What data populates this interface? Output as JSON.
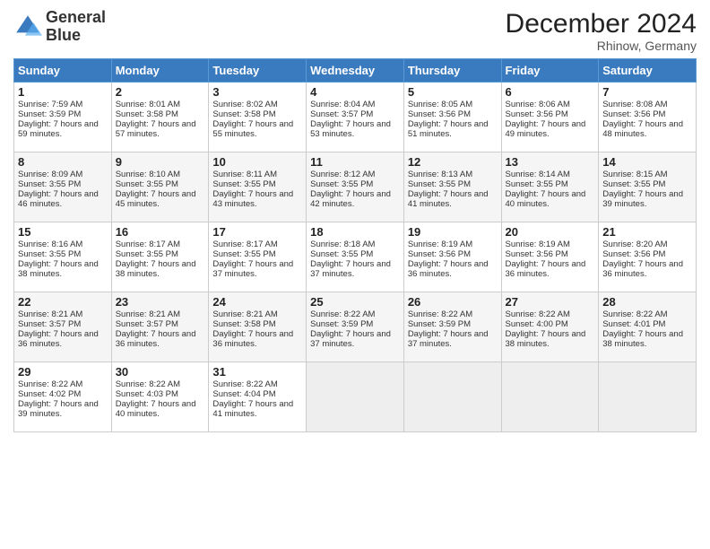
{
  "header": {
    "logo_line1": "General",
    "logo_line2": "Blue",
    "month": "December 2024",
    "location": "Rhinow, Germany"
  },
  "days_of_week": [
    "Sunday",
    "Monday",
    "Tuesday",
    "Wednesday",
    "Thursday",
    "Friday",
    "Saturday"
  ],
  "weeks": [
    [
      {
        "day": "1",
        "sunrise": "7:59 AM",
        "sunset": "3:59 PM",
        "daylight": "7 hours and 59 minutes."
      },
      {
        "day": "2",
        "sunrise": "8:01 AM",
        "sunset": "3:58 PM",
        "daylight": "7 hours and 57 minutes."
      },
      {
        "day": "3",
        "sunrise": "8:02 AM",
        "sunset": "3:58 PM",
        "daylight": "7 hours and 55 minutes."
      },
      {
        "day": "4",
        "sunrise": "8:04 AM",
        "sunset": "3:57 PM",
        "daylight": "7 hours and 53 minutes."
      },
      {
        "day": "5",
        "sunrise": "8:05 AM",
        "sunset": "3:56 PM",
        "daylight": "7 hours and 51 minutes."
      },
      {
        "day": "6",
        "sunrise": "8:06 AM",
        "sunset": "3:56 PM",
        "daylight": "7 hours and 49 minutes."
      },
      {
        "day": "7",
        "sunrise": "8:08 AM",
        "sunset": "3:56 PM",
        "daylight": "7 hours and 48 minutes."
      }
    ],
    [
      {
        "day": "8",
        "sunrise": "8:09 AM",
        "sunset": "3:55 PM",
        "daylight": "7 hours and 46 minutes."
      },
      {
        "day": "9",
        "sunrise": "8:10 AM",
        "sunset": "3:55 PM",
        "daylight": "7 hours and 45 minutes."
      },
      {
        "day": "10",
        "sunrise": "8:11 AM",
        "sunset": "3:55 PM",
        "daylight": "7 hours and 43 minutes."
      },
      {
        "day": "11",
        "sunrise": "8:12 AM",
        "sunset": "3:55 PM",
        "daylight": "7 hours and 42 minutes."
      },
      {
        "day": "12",
        "sunrise": "8:13 AM",
        "sunset": "3:55 PM",
        "daylight": "7 hours and 41 minutes."
      },
      {
        "day": "13",
        "sunrise": "8:14 AM",
        "sunset": "3:55 PM",
        "daylight": "7 hours and 40 minutes."
      },
      {
        "day": "14",
        "sunrise": "8:15 AM",
        "sunset": "3:55 PM",
        "daylight": "7 hours and 39 minutes."
      }
    ],
    [
      {
        "day": "15",
        "sunrise": "8:16 AM",
        "sunset": "3:55 PM",
        "daylight": "7 hours and 38 minutes."
      },
      {
        "day": "16",
        "sunrise": "8:17 AM",
        "sunset": "3:55 PM",
        "daylight": "7 hours and 38 minutes."
      },
      {
        "day": "17",
        "sunrise": "8:17 AM",
        "sunset": "3:55 PM",
        "daylight": "7 hours and 37 minutes."
      },
      {
        "day": "18",
        "sunrise": "8:18 AM",
        "sunset": "3:55 PM",
        "daylight": "7 hours and 37 minutes."
      },
      {
        "day": "19",
        "sunrise": "8:19 AM",
        "sunset": "3:56 PM",
        "daylight": "7 hours and 36 minutes."
      },
      {
        "day": "20",
        "sunrise": "8:19 AM",
        "sunset": "3:56 PM",
        "daylight": "7 hours and 36 minutes."
      },
      {
        "day": "21",
        "sunrise": "8:20 AM",
        "sunset": "3:56 PM",
        "daylight": "7 hours and 36 minutes."
      }
    ],
    [
      {
        "day": "22",
        "sunrise": "8:21 AM",
        "sunset": "3:57 PM",
        "daylight": "7 hours and 36 minutes."
      },
      {
        "day": "23",
        "sunrise": "8:21 AM",
        "sunset": "3:57 PM",
        "daylight": "7 hours and 36 minutes."
      },
      {
        "day": "24",
        "sunrise": "8:21 AM",
        "sunset": "3:58 PM",
        "daylight": "7 hours and 36 minutes."
      },
      {
        "day": "25",
        "sunrise": "8:22 AM",
        "sunset": "3:59 PM",
        "daylight": "7 hours and 37 minutes."
      },
      {
        "day": "26",
        "sunrise": "8:22 AM",
        "sunset": "3:59 PM",
        "daylight": "7 hours and 37 minutes."
      },
      {
        "day": "27",
        "sunrise": "8:22 AM",
        "sunset": "4:00 PM",
        "daylight": "7 hours and 38 minutes."
      },
      {
        "day": "28",
        "sunrise": "8:22 AM",
        "sunset": "4:01 PM",
        "daylight": "7 hours and 38 minutes."
      }
    ],
    [
      {
        "day": "29",
        "sunrise": "8:22 AM",
        "sunset": "4:02 PM",
        "daylight": "7 hours and 39 minutes."
      },
      {
        "day": "30",
        "sunrise": "8:22 AM",
        "sunset": "4:03 PM",
        "daylight": "7 hours and 40 minutes."
      },
      {
        "day": "31",
        "sunrise": "8:22 AM",
        "sunset": "4:04 PM",
        "daylight": "7 hours and 41 minutes."
      },
      null,
      null,
      null,
      null
    ]
  ],
  "labels": {
    "sunrise": "Sunrise:",
    "sunset": "Sunset:",
    "daylight": "Daylight:"
  }
}
